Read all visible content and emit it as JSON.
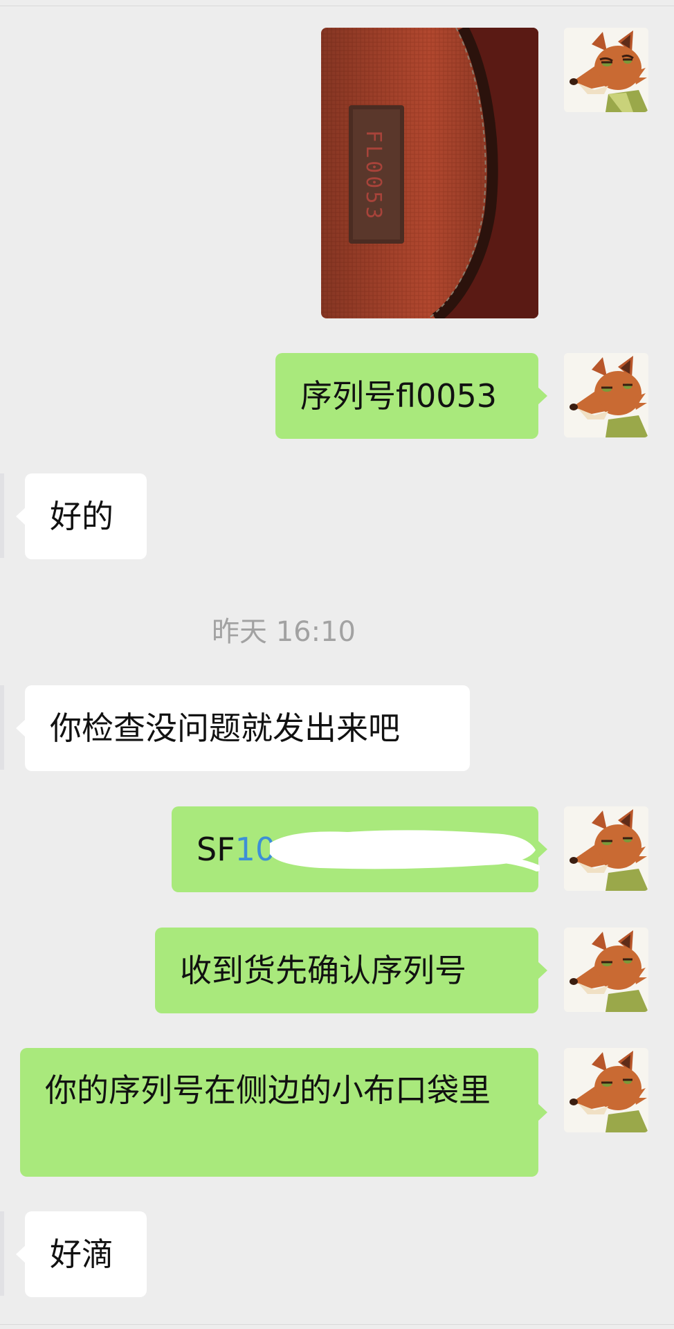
{
  "chat": {
    "timestamp": "昨天 16:10",
    "tag_serial": "FL0053",
    "messages": [
      {
        "side": "right",
        "text": "序列号fl0053"
      },
      {
        "side": "left",
        "text": "好的"
      },
      {
        "side": "left",
        "text": "你检查没问题就发出来吧"
      },
      {
        "side": "right",
        "prefix": "SF",
        "link": "10"
      },
      {
        "side": "right",
        "text": "收到货先确认序列号"
      },
      {
        "side": "right",
        "text": "你的序列号在侧边的小布口袋里"
      },
      {
        "side": "left",
        "text": "好滴"
      }
    ]
  },
  "colors": {
    "background": "#ededed",
    "bubble_sent": "#a9e97c",
    "bubble_received": "#ffffff",
    "link": "#3d8fd6",
    "timestamp": "#a2a2a2"
  },
  "icons": {
    "avatar": "fox-cartoon-avatar"
  }
}
